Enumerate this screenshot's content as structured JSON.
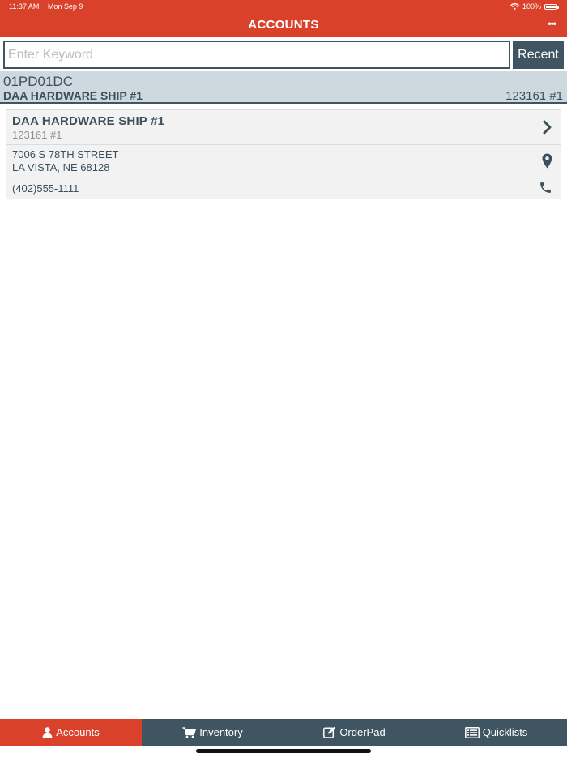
{
  "status_bar": {
    "time": "11:37 AM",
    "date": "Mon Sep 9",
    "battery": "100%"
  },
  "header": {
    "title": "ACCOUNTS",
    "more_label": "•••"
  },
  "search": {
    "placeholder": "Enter Keyword",
    "value": "",
    "recent_label": "Recent"
  },
  "selected_account": {
    "code": "01PD01DC",
    "name": "DAA HARDWARE SHIP #1",
    "number": "123161 #1"
  },
  "account": {
    "name": "DAA HARDWARE SHIP #1",
    "number": "123161 #1",
    "address_line1": "7006 S 78TH STREET",
    "address_line2": "LA VISTA, NE 68128",
    "phone": "(402)555-1111"
  },
  "tabs": [
    {
      "label": "Accounts",
      "icon": "person-icon",
      "active": true
    },
    {
      "label": "Inventory",
      "icon": "cart-icon",
      "active": false
    },
    {
      "label": "OrderPad",
      "icon": "edit-icon",
      "active": false
    },
    {
      "label": "Quicklists",
      "icon": "list-icon",
      "active": false
    }
  ],
  "colors": {
    "accent": "#d9412a",
    "primary": "#3f5562",
    "selected_bg": "#cdd9df"
  }
}
